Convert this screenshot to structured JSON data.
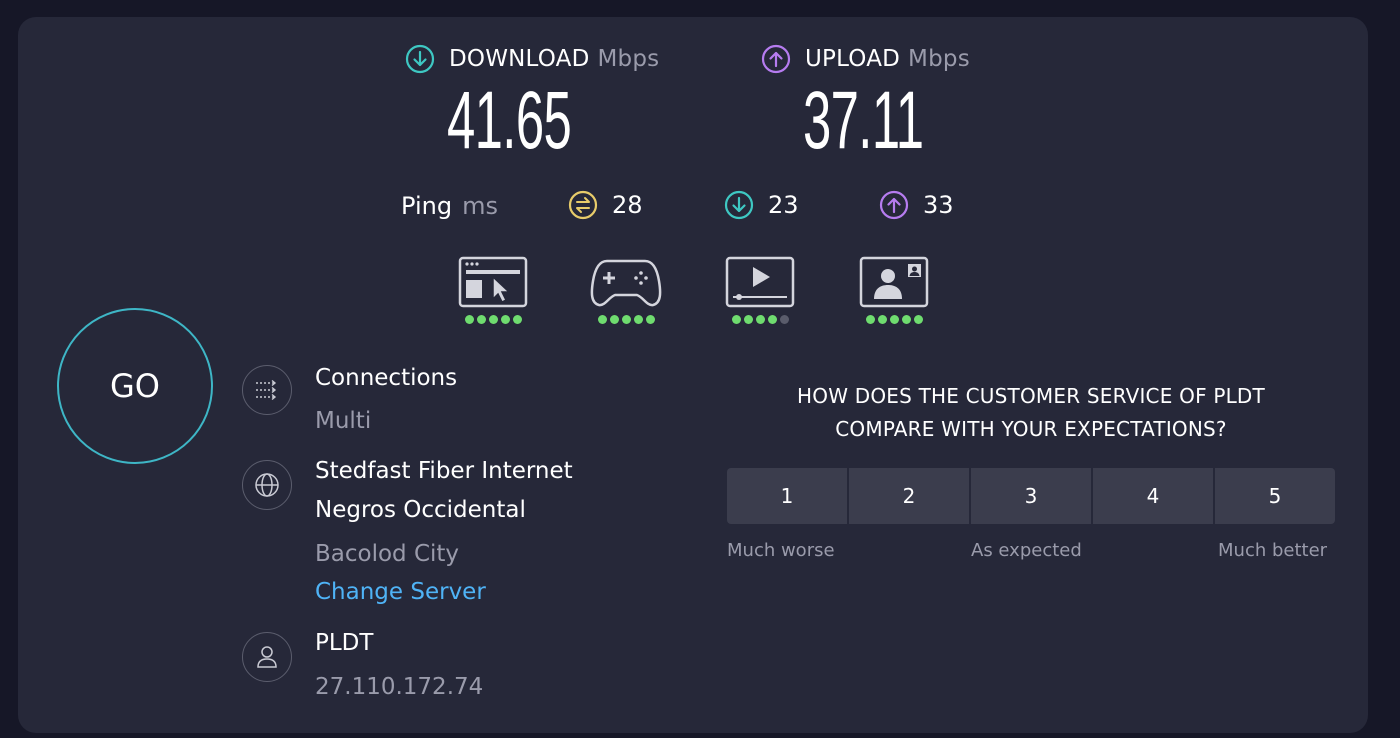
{
  "download": {
    "label": "DOWNLOAD",
    "unit": "Mbps",
    "value": "41.65",
    "icon": "arrow-down-circle-icon",
    "color": "#3ec8c3"
  },
  "upload": {
    "label": "UPLOAD",
    "unit": "Mbps",
    "value": "37.11",
    "icon": "arrow-up-circle-icon",
    "color": "#b67cf0"
  },
  "ping": {
    "label": "Ping",
    "unit": "ms",
    "idle": "28",
    "download": "23",
    "upload": "33",
    "idle_color": "#e8cc6a"
  },
  "quality": [
    {
      "icon": "web-browsing-icon",
      "rating": 5,
      "max": 5
    },
    {
      "icon": "gaming-controller-icon",
      "rating": 5,
      "max": 5
    },
    {
      "icon": "video-streaming-icon",
      "rating": 4,
      "max": 5
    },
    {
      "icon": "video-call-icon",
      "rating": 5,
      "max": 5
    }
  ],
  "go_label": "GO",
  "connections": {
    "title": "Connections",
    "value": "Multi",
    "icon": "connections-icon"
  },
  "server": {
    "name_line1": "Stedfast Fiber Internet",
    "name_line2": "Negros Occidental",
    "city": "Bacolod City",
    "change_label": "Change Server",
    "icon": "globe-icon"
  },
  "provider": {
    "name": "PLDT",
    "ip": "27.110.172.74",
    "icon": "user-icon"
  },
  "survey": {
    "question_line1": "HOW DOES THE CUSTOMER SERVICE OF PLDT",
    "question_line2": "COMPARE WITH YOUR EXPECTATIONS?",
    "options": [
      "1",
      "2",
      "3",
      "4",
      "5"
    ],
    "low_label": "Much worse",
    "mid_label": "As expected",
    "high_label": "Much better"
  }
}
